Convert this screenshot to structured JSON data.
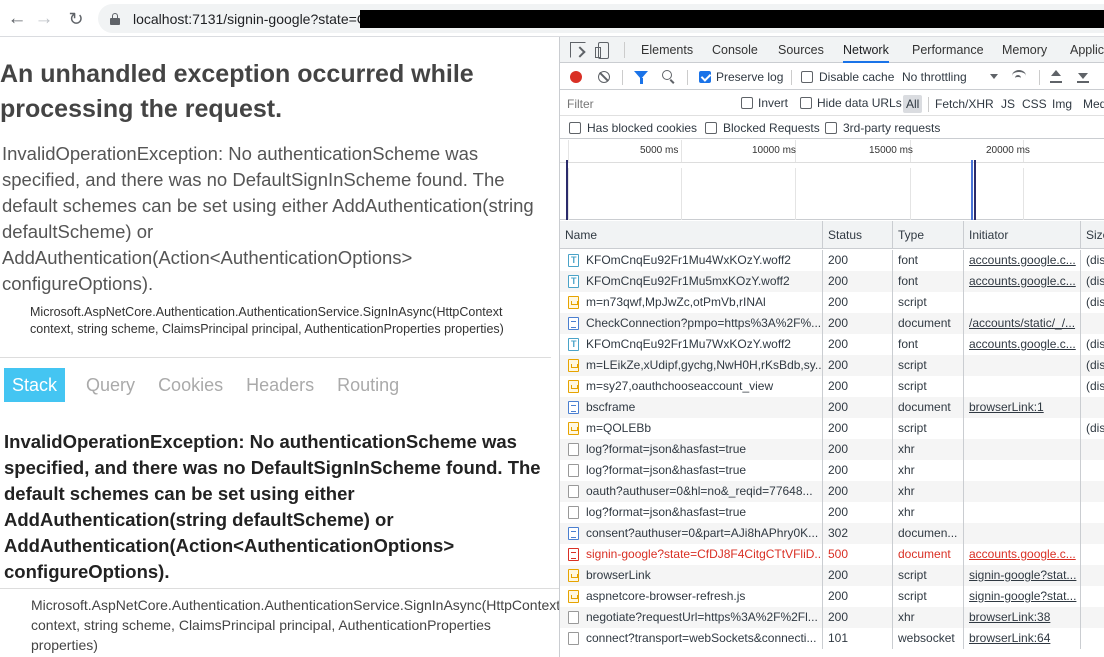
{
  "browser": {
    "url": "localhost:7131/signin-google?state=C",
    "icons": [
      "back-icon",
      "forward-icon",
      "reload-icon",
      "lock-icon"
    ]
  },
  "error_page": {
    "title": "An unhandled exception occurred while processing the request.",
    "message": "InvalidOperationException: No authenticationScheme was specified, and there was no DefaultSignInScheme found. The default schemes can be set using either AddAuthentication(string defaultScheme) or AddAuthentication(Action<AuthenticationOptions> configureOptions).",
    "location": "Microsoft.AspNetCore.Authentication.AuthenticationService.SignInAsync(HttpContext context, string scheme, ClaimsPrincipal principal, AuthenticationProperties properties)",
    "tabs": [
      "Stack",
      "Query",
      "Cookies",
      "Headers",
      "Routing"
    ],
    "active_tab": "Stack",
    "stack_title": "InvalidOperationException: No authenticationScheme was specified, and there was no DefaultSignInScheme found. The default schemes can be set using either AddAuthentication(string defaultScheme) or AddAuthentication(Action<AuthenticationOptions> configureOptions).",
    "stack_location": "Microsoft.AspNetCore.Authentication.AuthenticationService.SignInAsync(HttpContext context, string scheme, ClaimsPrincipal principal, AuthenticationProperties properties)",
    "accent_color": "#44c5f2"
  },
  "devtools": {
    "tabs": [
      "Elements",
      "Console",
      "Sources",
      "Network",
      "Performance",
      "Memory",
      "Applic"
    ],
    "active_tab": "Network",
    "toolbar": {
      "preserve_log": "Preserve log",
      "preserve_log_checked": true,
      "disable_cache": "Disable cache",
      "throttling": "No throttling"
    },
    "filter": {
      "placeholder": "Filter",
      "invert": "Invert",
      "hide_data_urls": "Hide data URLs",
      "all": "All",
      "types": [
        "Fetch/XHR",
        "JS",
        "CSS",
        "Img",
        "Med"
      ]
    },
    "blocked": {
      "has_blocked_cookies": "Has blocked cookies",
      "blocked_requests": "Blocked Requests",
      "third_party": "3rd-party requests"
    },
    "timeline_labels": [
      "5000 ms",
      "10000 ms",
      "15000 ms",
      "20000 ms"
    ],
    "columns": [
      "Name",
      "Status",
      "Type",
      "Initiator",
      "Size"
    ],
    "requests": [
      {
        "name": "KFOmCnqEu92Fr1Mu4WxKOzY.woff2",
        "status": "200",
        "type": "font",
        "initiator": "accounts.google.c...",
        "size": "(dis",
        "icon": "font"
      },
      {
        "name": "KFOmCnqEu92Fr1Mu5mxKOzY.woff2",
        "status": "200",
        "type": "font",
        "initiator": "accounts.google.c...",
        "size": "(dis",
        "icon": "font"
      },
      {
        "name": "m=n73qwf,MpJwZc,otPmVb,rINAl",
        "status": "200",
        "type": "script",
        "initiator": "",
        "size": "(dis",
        "icon": "script"
      },
      {
        "name": "CheckConnection?pmpo=https%3A%2F%...",
        "status": "200",
        "type": "document",
        "initiator": "/accounts/static/_/...",
        "size": "",
        "icon": "document"
      },
      {
        "name": "KFOmCnqEu92Fr1Mu7WxKOzY.woff2",
        "status": "200",
        "type": "font",
        "initiator": "accounts.google.c...",
        "size": "(dis",
        "icon": "font"
      },
      {
        "name": "m=LEikZe,xUdipf,gychg,NwH0H,rKsBdb,sy...",
        "status": "200",
        "type": "script",
        "initiator": "",
        "size": "(dis",
        "icon": "script"
      },
      {
        "name": "m=sy27,oauthchooseaccount_view",
        "status": "200",
        "type": "script",
        "initiator": "",
        "size": "(dis",
        "icon": "script"
      },
      {
        "name": "bscframe",
        "status": "200",
        "type": "document",
        "initiator": "browserLink:1",
        "size": "",
        "icon": "document"
      },
      {
        "name": "m=QOLEBb",
        "status": "200",
        "type": "script",
        "initiator": "",
        "size": "(dis",
        "icon": "script"
      },
      {
        "name": "log?format=json&hasfast=true",
        "status": "200",
        "type": "xhr",
        "initiator": "",
        "size": "",
        "icon": "xhr"
      },
      {
        "name": "log?format=json&hasfast=true",
        "status": "200",
        "type": "xhr",
        "initiator": "",
        "size": "",
        "icon": "xhr"
      },
      {
        "name": "oauth?authuser=0&hl=no&_reqid=77648...",
        "status": "200",
        "type": "xhr",
        "initiator": "",
        "size": "",
        "icon": "xhr"
      },
      {
        "name": "log?format=json&hasfast=true",
        "status": "200",
        "type": "xhr",
        "initiator": "",
        "size": "",
        "icon": "xhr"
      },
      {
        "name": "consent?authuser=0&part=AJi8hAPhry0K...",
        "status": "302",
        "type": "documen...",
        "initiator": "",
        "size": "",
        "icon": "document"
      },
      {
        "name": "signin-google?state=CfDJ8F4CitgCTtVFliD...",
        "status": "500",
        "type": "document",
        "initiator": "accounts.google.c...",
        "size": "",
        "icon": "error",
        "error": true
      },
      {
        "name": "browserLink",
        "status": "200",
        "type": "script",
        "initiator": "signin-google?stat...",
        "size": "",
        "icon": "script"
      },
      {
        "name": "aspnetcore-browser-refresh.js",
        "status": "200",
        "type": "script",
        "initiator": "signin-google?stat...",
        "size": "",
        "icon": "script"
      },
      {
        "name": "negotiate?requestUrl=https%3A%2F%2Fl...",
        "status": "200",
        "type": "xhr",
        "initiator": "browserLink:38",
        "size": "",
        "icon": "xhr"
      },
      {
        "name": "connect?transport=webSockets&connecti...",
        "status": "101",
        "type": "websocket",
        "initiator": "browserLink:64",
        "size": "",
        "icon": "xhr"
      }
    ]
  }
}
